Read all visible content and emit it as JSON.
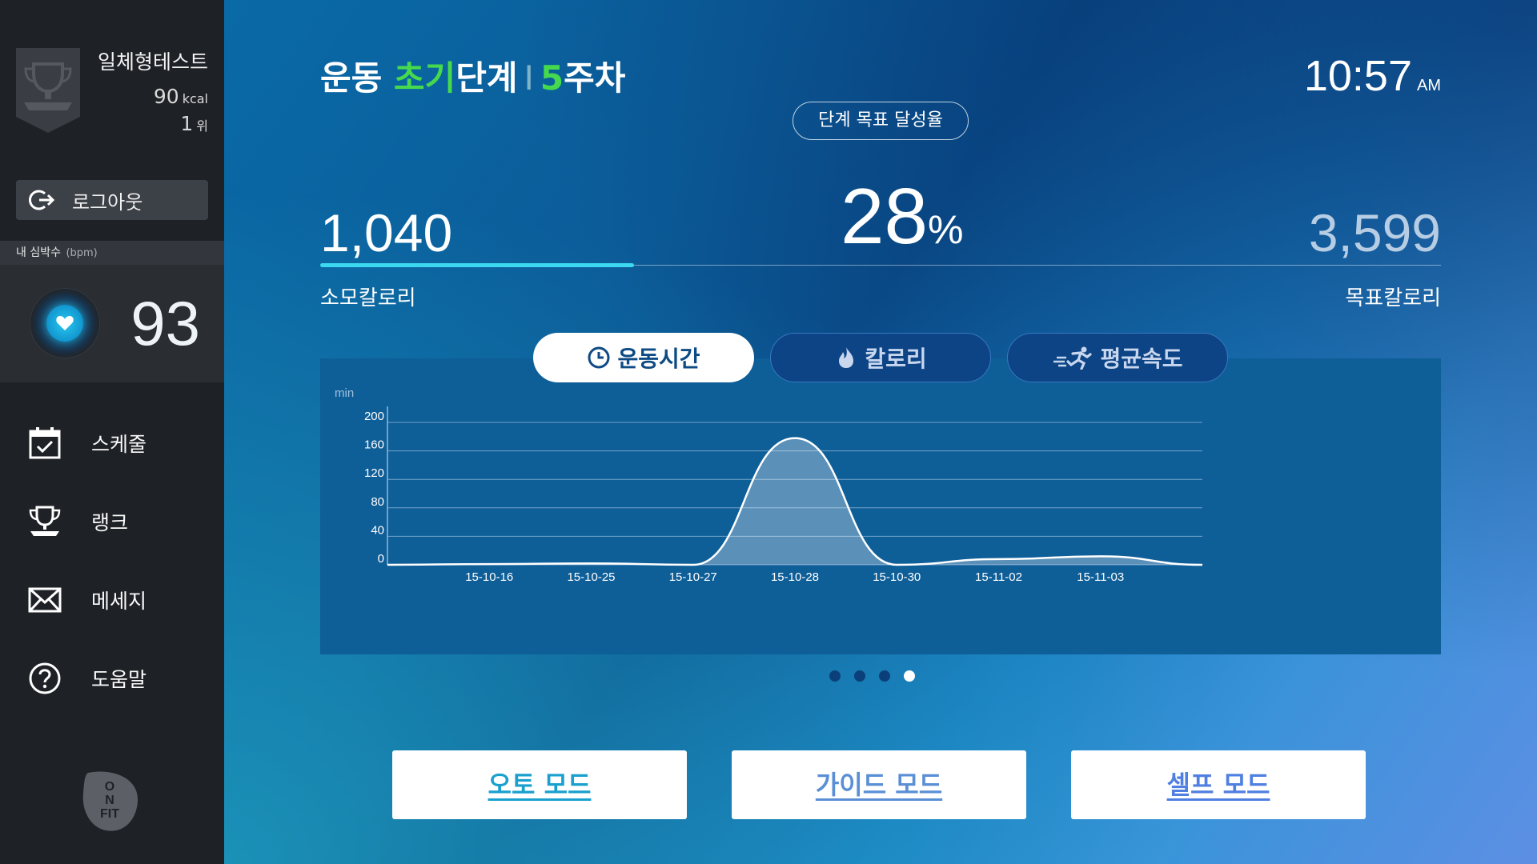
{
  "sidebar": {
    "user_name": "일체형테스트",
    "kcal_value": "90",
    "kcal_unit": "kcal",
    "rank_value": "1",
    "rank_unit": "위",
    "logout_label": "로그아웃",
    "heart_rate_label": "내 심박수",
    "heart_rate_unit": "(bpm)",
    "heart_rate_value": "93",
    "nav": [
      {
        "label": "스케줄",
        "icon": "calendar-check-icon"
      },
      {
        "label": "랭크",
        "icon": "trophy-icon"
      },
      {
        "label": "메세지",
        "icon": "envelope-icon"
      },
      {
        "label": "도움말",
        "icon": "help-circle-icon"
      }
    ],
    "logo_text": [
      "O",
      "N",
      "FIT"
    ]
  },
  "header": {
    "title_part1": "운동 ",
    "title_highlight": "초기",
    "title_part2": "단계",
    "title_sep": "I",
    "week_num": "5",
    "week_label": "주차",
    "time": "10:57",
    "ampm": "AM"
  },
  "progress": {
    "goal_pill": "단계 목표 달성율",
    "burned": "1,040",
    "burned_label": "소모칼로리",
    "percent": "28",
    "percent_sign": "%",
    "percent_fraction": 0.28,
    "goal": "3,599",
    "goal_label": "목표칼로리"
  },
  "tabs": [
    {
      "label": "운동시간",
      "icon": "clock-icon",
      "active": true
    },
    {
      "label": "칼로리",
      "icon": "flame-icon",
      "active": false
    },
    {
      "label": "평균속도",
      "icon": "running-icon",
      "active": false
    }
  ],
  "chart_data": {
    "type": "area",
    "ylabel": "min",
    "ylim": [
      0,
      200
    ],
    "yticks": [
      0,
      40,
      80,
      120,
      160,
      200
    ],
    "categories": [
      "15-10-16",
      "15-10-25",
      "15-10-27",
      "15-10-28",
      "15-10-30",
      "15-11-02",
      "15-11-03"
    ],
    "series": [
      {
        "values": [
          1,
          2,
          0,
          178,
          0,
          8,
          12
        ]
      }
    ],
    "grid": true
  },
  "pager": {
    "count": 4,
    "active_index": 3
  },
  "modes": {
    "auto": "오토 모드",
    "guide": "가이드 모드",
    "self": "셀프 모드"
  },
  "colors": {
    "accent_green": "#46d94e",
    "progress_cyan": "#3cd8f0",
    "sidebar_bg": "#1e2126"
  }
}
